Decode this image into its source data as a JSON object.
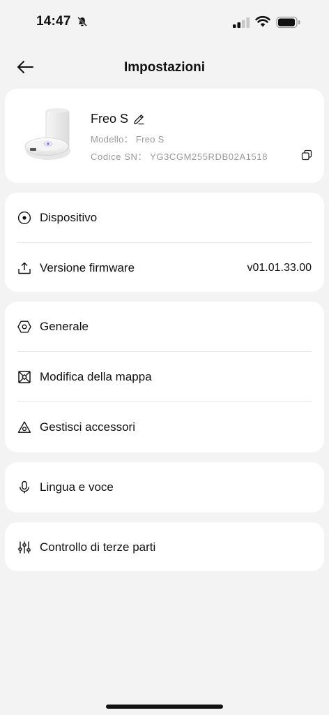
{
  "status_bar": {
    "time": "14:47"
  },
  "header": {
    "title": "Impostazioni"
  },
  "device": {
    "name": "Freo S",
    "model": "Modello： Freo S",
    "sn": "Codice SN： YG3CGM255RDB02A1518"
  },
  "sections": {
    "dispositivo": {
      "label": "Dispositivo"
    },
    "firmware": {
      "label": "Versione firmware",
      "value": "v01.01.33.00"
    },
    "generale": {
      "label": "Generale"
    },
    "mappa": {
      "label": "Modifica della mappa"
    },
    "accessori": {
      "label": "Gestisci accessori"
    },
    "lingua": {
      "label": "Lingua e voce"
    },
    "terze_parti": {
      "label": "Controllo di terze parti"
    }
  }
}
